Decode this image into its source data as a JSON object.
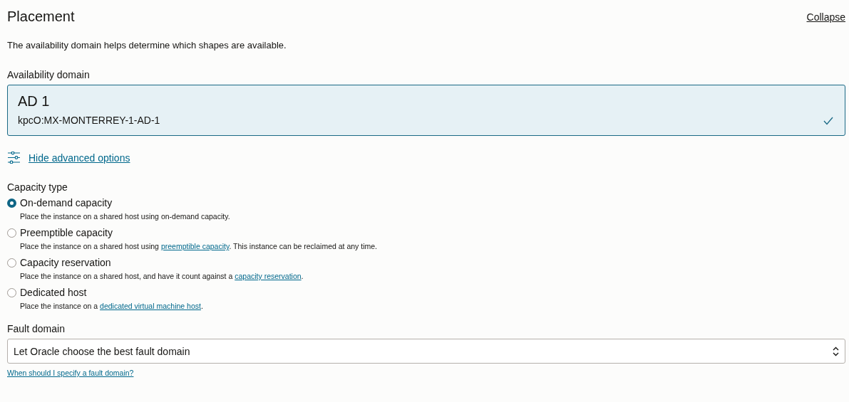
{
  "section": {
    "title": "Placement",
    "collapse_link": "Collapse",
    "description": "The availability domain helps determine which shapes are available."
  },
  "availability_domain": {
    "label": "Availability domain",
    "cards": [
      {
        "name": "AD 1",
        "id": "kpcO:MX-MONTERREY-1-AD-1",
        "selected": true
      }
    ]
  },
  "advanced_toggle": "Hide advanced options",
  "capacity_type": {
    "label": "Capacity type",
    "options": [
      {
        "label": "On-demand capacity",
        "selected": true,
        "description": [
          {
            "kind": "text",
            "text": "Place the instance on a shared host using on-demand capacity."
          }
        ]
      },
      {
        "label": "Preemptible capacity",
        "selected": false,
        "description": [
          {
            "kind": "text",
            "text": "Place the instance on a shared host using "
          },
          {
            "kind": "link",
            "text": "preemptible capacity"
          },
          {
            "kind": "text",
            "text": ". This instance can be reclaimed at any time."
          }
        ]
      },
      {
        "label": "Capacity reservation",
        "selected": false,
        "description": [
          {
            "kind": "text",
            "text": "Place the instance on a shared host, and have it count against a "
          },
          {
            "kind": "link",
            "text": "capacity reservation"
          },
          {
            "kind": "text",
            "text": "."
          }
        ]
      },
      {
        "label": "Dedicated host",
        "selected": false,
        "description": [
          {
            "kind": "text",
            "text": "Place the instance on a "
          },
          {
            "kind": "link",
            "text": "dedicated virtual machine host"
          },
          {
            "kind": "text",
            "text": "."
          }
        ]
      }
    ]
  },
  "fault_domain": {
    "label": "Fault domain",
    "value": "Let Oracle choose the best fault domain",
    "help_link": "When should I specify a fault domain?"
  }
}
